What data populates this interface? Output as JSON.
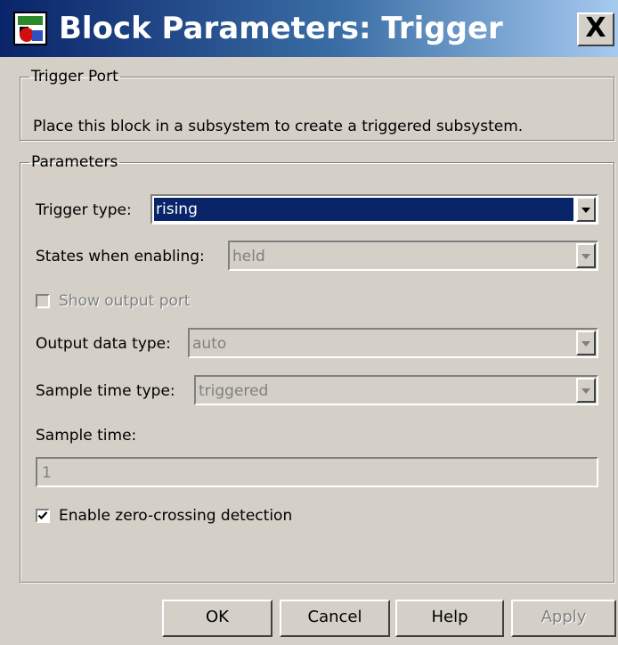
{
  "window": {
    "title": "Block Parameters: Trigger",
    "close_label": "X",
    "icon": "simulink-block-icon"
  },
  "trigger_port": {
    "legend": "Trigger Port",
    "description": "Place this block in a subsystem to create a triggered subsystem."
  },
  "parameters": {
    "legend": "Parameters",
    "trigger_type": {
      "label": "Trigger type:",
      "value": "rising"
    },
    "states_when_enabling": {
      "label": "States when enabling:",
      "value": "held"
    },
    "show_output_port": {
      "label": "Show output port",
      "checked": false
    },
    "output_data_type": {
      "label": "Output data type:",
      "value": "auto"
    },
    "sample_time_type": {
      "label": "Sample time type:",
      "value": "triggered"
    },
    "sample_time": {
      "label": "Sample time:",
      "value": "1"
    },
    "zero_crossing": {
      "label": "Enable zero-crossing detection",
      "checked": true
    }
  },
  "buttons": {
    "ok": "OK",
    "cancel": "Cancel",
    "help": "Help",
    "apply": "Apply"
  },
  "colors": {
    "title_gradient_start": "#0a246a",
    "selection": "#0a246a",
    "face": "#d4d0c8"
  }
}
